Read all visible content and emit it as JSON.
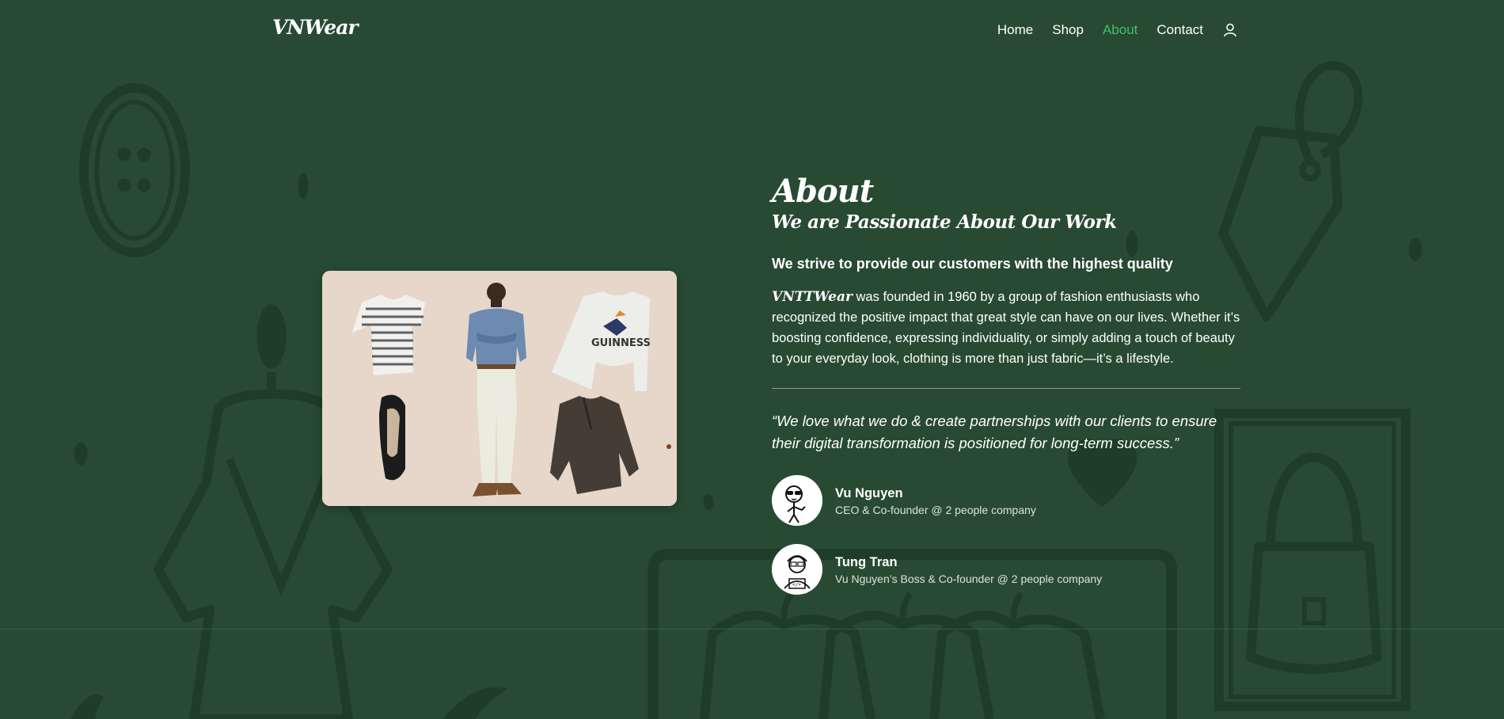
{
  "nav": {
    "logo": "VNWear",
    "links": [
      "Home",
      "Shop",
      "About",
      "Contact"
    ],
    "active": "About",
    "user_icon": "user-icon"
  },
  "about": {
    "title": "About",
    "subtitle": "We are Passionate About Our Work",
    "lead": "We strive to provide our customers with the highest quality",
    "brand": "VNTTWear",
    "paragraph": "was founded in 1960 by a group of fashion enthusiasts who recognized the positive impact that great style can have on our lives. Whether it’s boosting confidence, expressing individuality, or simply adding a touch of beauty to your everyday look, clothing is more than just fabric—it’s a lifestyle.",
    "quote": "“We love what we do & create partnerships with our clients to ensure their digital transformation is positioned for long-term success.”"
  },
  "people": [
    {
      "name": "Vu Nguyen",
      "role": "CEO & Co-founder @ 2 people company"
    },
    {
      "name": "Tung Tran",
      "role": "Vu Nguyen’s Boss & Co-founder @ 2 people company"
    }
  ],
  "colors": {
    "background": "#284a33",
    "accent": "#3fc06a",
    "text": "#ffffff"
  }
}
